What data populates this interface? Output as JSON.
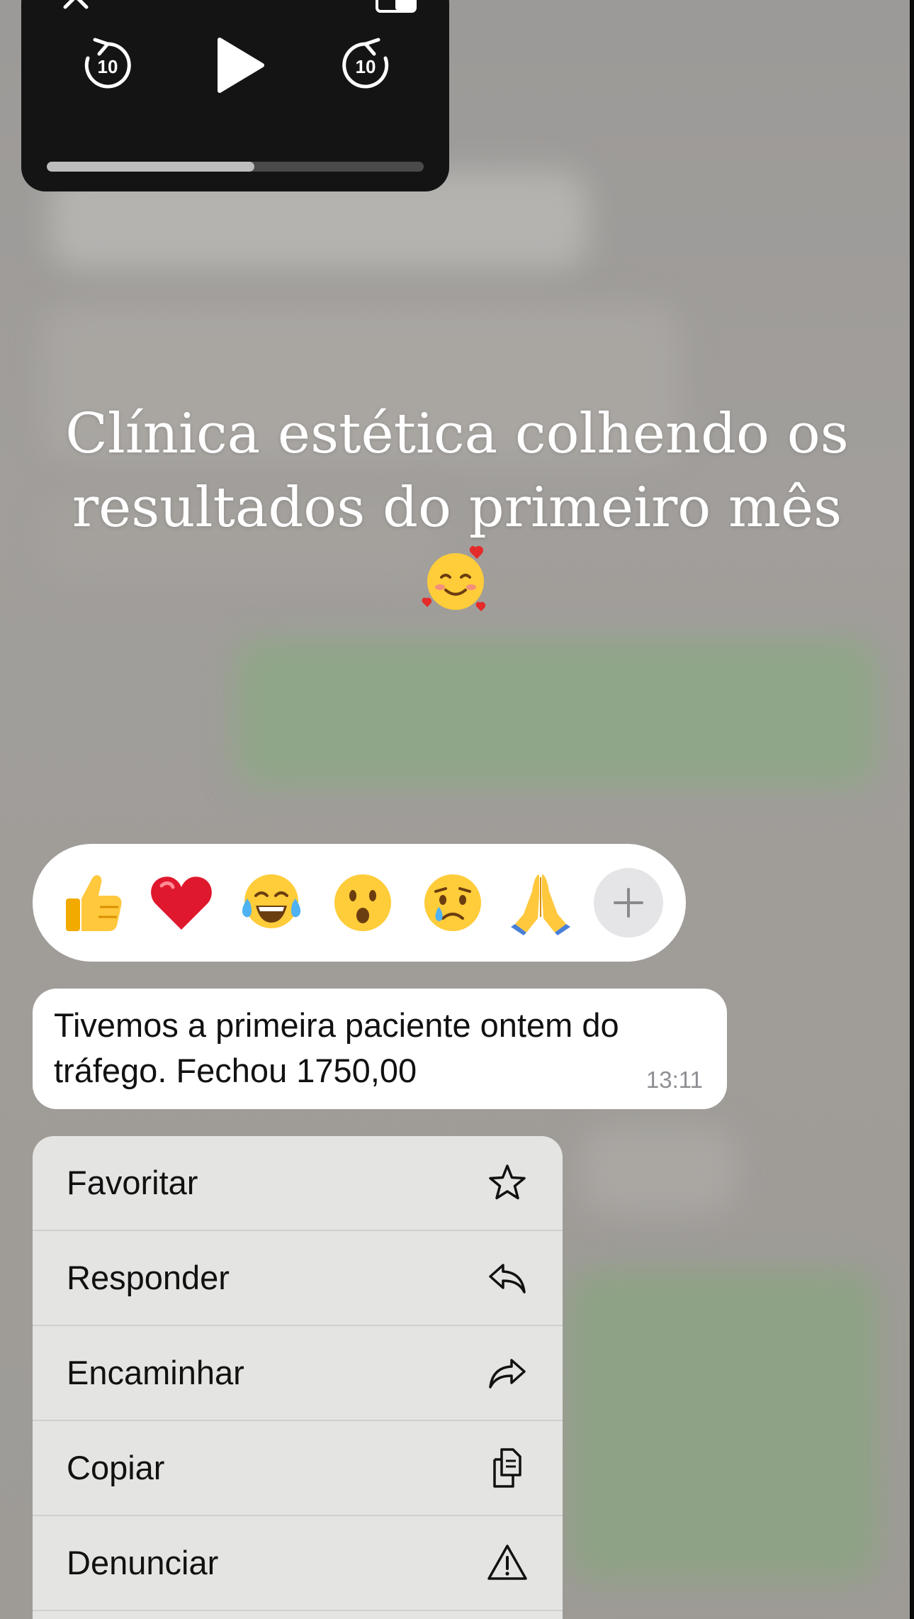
{
  "caption": {
    "line1": "Clínica estética colhendo os",
    "line2": "resultados do primeiro mês",
    "emoji": "🥰"
  },
  "video_player": {
    "skip_back_seconds": "10",
    "skip_forward_seconds": "10",
    "progress_fraction": 0.55,
    "icons": [
      "close-icon",
      "skip-back-10-icon",
      "play-icon",
      "skip-forward-10-icon",
      "picture-in-picture-icon"
    ]
  },
  "reactions": {
    "items": [
      {
        "name": "thumbs-up",
        "emoji": "👍"
      },
      {
        "name": "heart",
        "emoji": "❤️"
      },
      {
        "name": "tears-of-joy",
        "emoji": "😂"
      },
      {
        "name": "surprised",
        "emoji": "😮"
      },
      {
        "name": "crying",
        "emoji": "😢"
      },
      {
        "name": "praying-hands",
        "emoji": "🙏"
      }
    ],
    "more_icon": "plus-icon"
  },
  "message": {
    "line1": "Tivemos a primeira paciente ontem do",
    "line2": "tráfego. Fechou 1750,00",
    "time": "13:11"
  },
  "menu": {
    "items": [
      {
        "label": "Favoritar",
        "icon": "star-icon"
      },
      {
        "label": "Responder",
        "icon": "reply-icon"
      },
      {
        "label": "Encaminhar",
        "icon": "forward-icon"
      },
      {
        "label": "Copiar",
        "icon": "copy-icon"
      },
      {
        "label": "Denunciar",
        "icon": "warning-icon"
      }
    ]
  },
  "colors": {
    "bubble_background": "#ffffff",
    "menu_background": "#e8e9e6",
    "player_background": "#141414",
    "timestamp": "#8e8e93"
  }
}
